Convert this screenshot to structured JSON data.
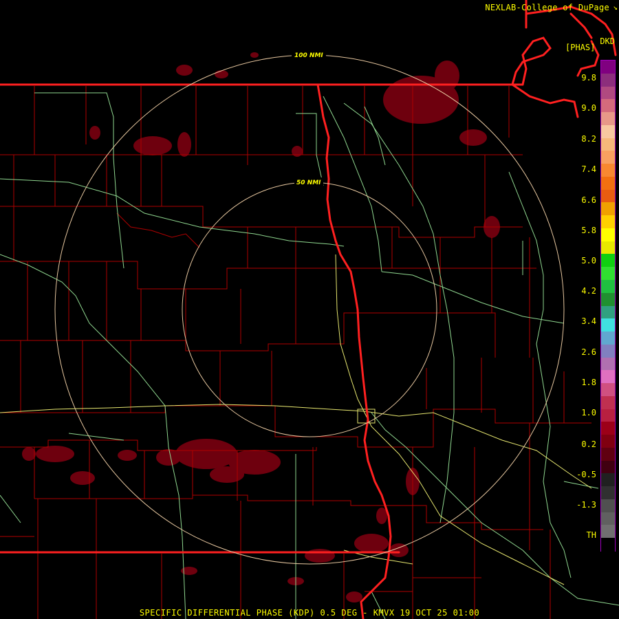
{
  "header": {
    "credit": "NEXLAB-College of DuPage",
    "credit_icon": "corner-logo-icon",
    "product_code": "DKD",
    "unit_label": "[PHAS]"
  },
  "map": {
    "ring_labels": [
      "100 NMI",
      "50 NMI"
    ],
    "colors": {
      "background": "#000000",
      "county_lines": "#b00000",
      "state_lines": "#ff2020",
      "highways": "#90d890",
      "interstate": "#e8e870",
      "range_rings": "#e8c8a0",
      "echo": "#7a0010"
    }
  },
  "legend": {
    "ticks": [
      "9.8",
      "9.0",
      "8.2",
      "7.4",
      "6.6",
      "5.8",
      "5.0",
      "4.2",
      "3.4",
      "2.6",
      "1.8",
      "1.0",
      "0.2",
      "-0.5",
      "-1.3",
      "TH"
    ],
    "scale_colors": [
      "#800080",
      "#8c2e7c",
      "#b04a80",
      "#d46a7c",
      "#e89888",
      "#f8c8a0",
      "#f6b87a",
      "#f8a060",
      "#f88830",
      "#f27010",
      "#e85c10",
      "#f0a000",
      "#ffd000",
      "#ffff00",
      "#e8e800",
      "#10d010",
      "#30e030",
      "#20c040",
      "#209030",
      "#30a080",
      "#40e0e0",
      "#60a8d0",
      "#8080c0",
      "#b070b0",
      "#e070c0",
      "#d05080",
      "#c03050",
      "#b82040",
      "#9c0018",
      "#800010",
      "#600010",
      "#400010",
      "#202020",
      "#303030",
      "#505050",
      "#606060",
      "#707070",
      "#000000"
    ]
  },
  "footer": {
    "caption": "SPECIFIC DIFFERENTIAL PHASE (KDP) 0.5 DEG - KMVX 19 OCT 25 01:00"
  }
}
